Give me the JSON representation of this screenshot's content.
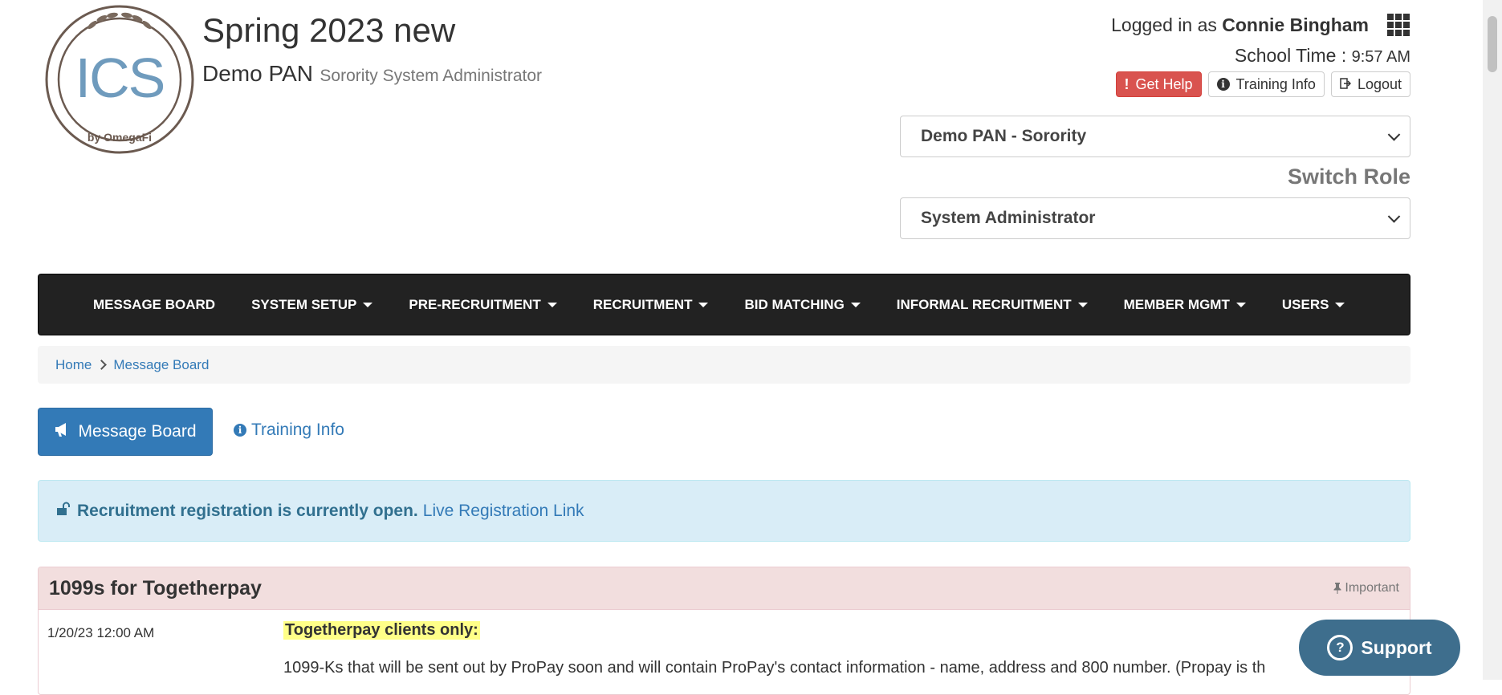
{
  "header": {
    "logo_text": "ICS",
    "logo_sub": "by OmegaFi",
    "title": "Spring 2023 new",
    "org_name": "Demo PAN",
    "role_name": "Sorority System Administrator",
    "logged_in_prefix": "Logged in as ",
    "user_name": "Connie Bingham",
    "school_time_label": "School Time : ",
    "school_time_value": "9:57 AM",
    "get_help_label": "Get Help",
    "training_info_label": "Training Info",
    "logout_label": "Logout",
    "org_select_value": "Demo PAN - Sorority",
    "switch_role_label": "Switch Role",
    "role_select_value": "System Administrator"
  },
  "nav": {
    "items": [
      {
        "label": "MESSAGE BOARD",
        "dropdown": false
      },
      {
        "label": "SYSTEM SETUP",
        "dropdown": true
      },
      {
        "label": "PRE-RECRUITMENT",
        "dropdown": true
      },
      {
        "label": "RECRUITMENT",
        "dropdown": true
      },
      {
        "label": "BID MATCHING",
        "dropdown": true
      },
      {
        "label": "INFORMAL RECRUITMENT",
        "dropdown": true
      },
      {
        "label": "MEMBER MGMT",
        "dropdown": true
      },
      {
        "label": "USERS",
        "dropdown": true
      }
    ]
  },
  "breadcrumb": {
    "home": "Home",
    "current": "Message Board"
  },
  "actions": {
    "message_board_label": "Message Board",
    "training_info_label": "Training Info"
  },
  "alert": {
    "text": "Recruitment registration is currently open.",
    "link": "Live Registration Link"
  },
  "post": {
    "title": "1099s for Togetherpay",
    "tag": "Important",
    "date": "1/20/23 12:00 AM",
    "heading": "Togetherpay clients only:",
    "body": "1099-Ks that will be sent out by ProPay soon and will contain ProPay's contact information - name, address and 800 number. (Propay is th"
  },
  "support": {
    "label": "Support"
  },
  "colors": {
    "navbar_bg": "#222222",
    "primary": "#337ab7",
    "danger": "#d9534f",
    "alert_bg": "#d9edf7",
    "panel_head_bg": "#f2dede",
    "highlight": "#ffff88",
    "support_bg": "#3e6e8d"
  }
}
